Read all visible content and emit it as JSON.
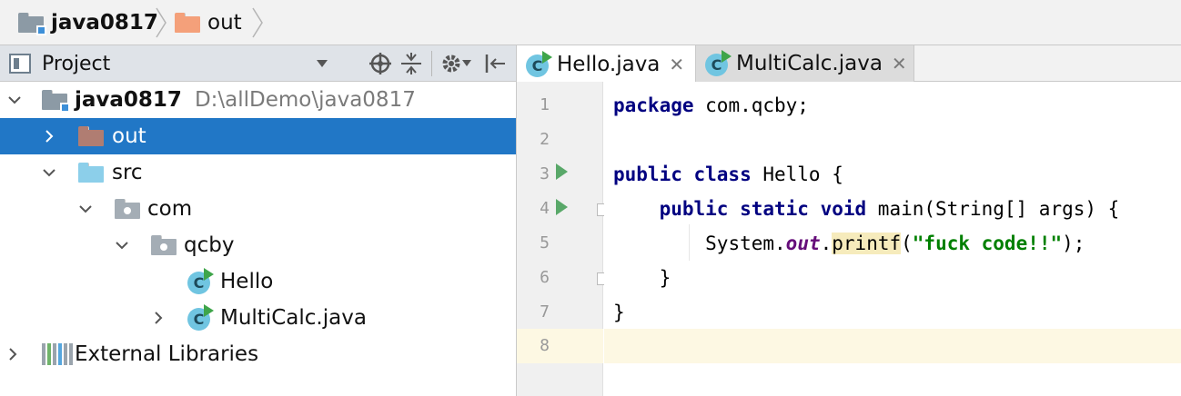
{
  "breadcrumb": {
    "project": "java0817",
    "folder": "out"
  },
  "project_panel": {
    "title": "Project",
    "tree": [
      {
        "label": "java0817",
        "path": "D:\\allDemo\\java0817"
      },
      {
        "label": "out"
      },
      {
        "label": "src"
      },
      {
        "label": "com"
      },
      {
        "label": "qcby"
      },
      {
        "label": "Hello"
      },
      {
        "label": "MultiCalc.java"
      },
      {
        "label": "External Libraries"
      }
    ]
  },
  "editor": {
    "tabs": [
      {
        "label": "Hello.java",
        "active": true
      },
      {
        "label": "MultiCalc.java",
        "active": false
      }
    ],
    "line_numbers": [
      "1",
      "2",
      "3",
      "4",
      "5",
      "6",
      "7",
      "8"
    ],
    "code": {
      "l1_kw": "package",
      "l1_rest": " com.qcby;",
      "l3_kw": "public class",
      "l3_rest": " Hello {",
      "l4_indent": "    ",
      "l4_kw": "public static void",
      "l4_rest": " main(String[] args) {",
      "l5_indent": "        ",
      "l5_a": "System.",
      "l5_field": "out",
      "l5_dot": ".",
      "l5_method": "printf",
      "l5_open": "(",
      "l5_string": "\"fuck code!!\"",
      "l5_close": ");",
      "l6": "    }",
      "l7": "}"
    }
  },
  "icons": {
    "class_letter": "C",
    "tab_close": "✕"
  },
  "colors": {
    "selection": "#2177c6",
    "keyword": "#000080",
    "string": "#008000",
    "field": "#660e7a",
    "current_line": "#fdf8e3"
  }
}
